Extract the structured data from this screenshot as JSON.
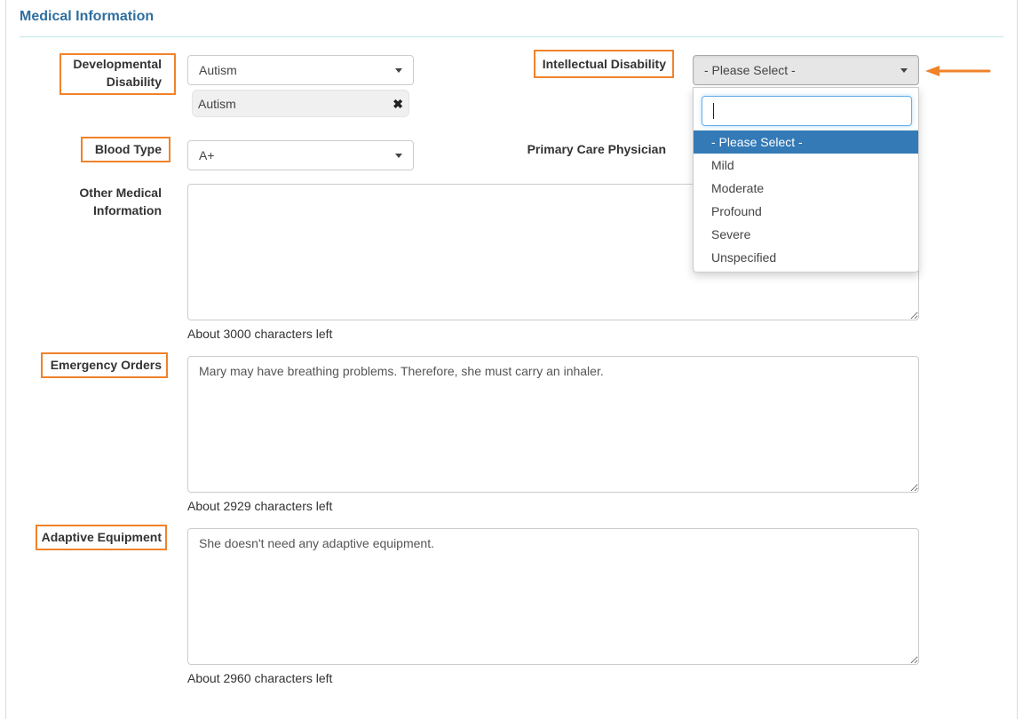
{
  "section": {
    "title": "Medical Information"
  },
  "developmental_disability": {
    "label_line1": "Developmental",
    "label_line2": "Disability",
    "selected": "Autism",
    "tags": [
      {
        "label": "Autism",
        "remove_icon": "times-icon"
      }
    ]
  },
  "intellectual_disability": {
    "label": "Intellectual Disability",
    "selected": "- Please Select -",
    "dropdown": {
      "search_value": "",
      "options": [
        {
          "label": "- Please Select -",
          "active": true
        },
        {
          "label": "Mild",
          "active": false
        },
        {
          "label": "Moderate",
          "active": false
        },
        {
          "label": "Profound",
          "active": false
        },
        {
          "label": "Severe",
          "active": false
        },
        {
          "label": "Unspecified",
          "active": false
        }
      ]
    }
  },
  "blood_type": {
    "label": "Blood Type",
    "selected": "A+"
  },
  "primary_care_physician": {
    "label": "Primary Care Physician"
  },
  "other_medical_information": {
    "label_line1": "Other Medical",
    "label_line2": "Information",
    "value": "",
    "counter": "About 3000 characters left"
  },
  "emergency_orders": {
    "label": "Emergency Orders",
    "value": "Mary may have breathing problems. Therefore, she must carry an inhaler.",
    "counter": "About 2929 characters left"
  },
  "adaptive_equipment": {
    "label": "Adaptive Equipment",
    "value": "She doesn't need any adaptive equipment.",
    "counter": "About 2960 characters left"
  },
  "annotations": {
    "highlight_color": "#f0822a",
    "arrow_icon": "arrow-left-icon"
  }
}
